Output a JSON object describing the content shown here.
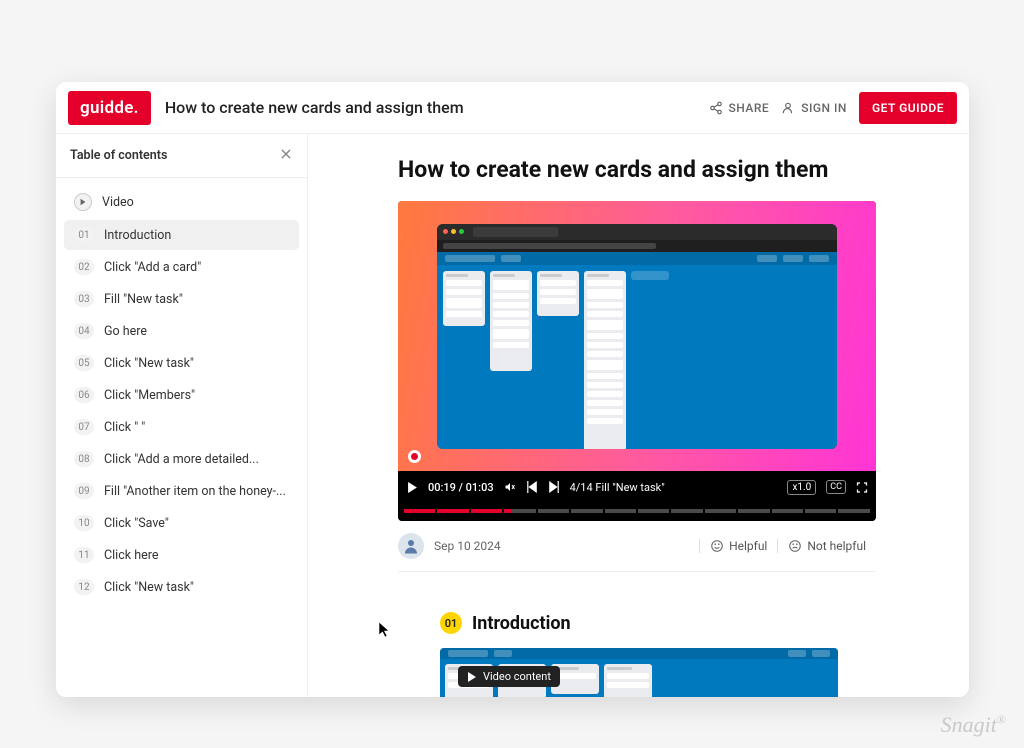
{
  "brand": "guidde",
  "header": {
    "title": "How to create new cards and assign them",
    "share": "Share",
    "sign_in": "Sign In",
    "cta": "Get Guidde"
  },
  "toc": {
    "title": "Table of contents",
    "video_label": "Video",
    "items": [
      {
        "num": "01",
        "label": "Introduction"
      },
      {
        "num": "02",
        "label": "Click \"Add a card\""
      },
      {
        "num": "03",
        "label": "Fill \"New task\""
      },
      {
        "num": "04",
        "label": "Go here"
      },
      {
        "num": "05",
        "label": "Click \"New task\""
      },
      {
        "num": "06",
        "label": "Click \"Members\""
      },
      {
        "num": "07",
        "label": "Click \"              \""
      },
      {
        "num": "08",
        "label": "Click \"Add a more detailed..."
      },
      {
        "num": "09",
        "label": "Fill \"Another item on the honey-..."
      },
      {
        "num": "10",
        "label": "Click \"Save\""
      },
      {
        "num": "11",
        "label": "Click here"
      },
      {
        "num": "12",
        "label": "Click \"New task\""
      }
    ]
  },
  "video": {
    "time_current": "00:19",
    "time_total": "01:03",
    "time_display": "00:19 / 01:03",
    "chapter_label": "4/14 Fill \"New task\"",
    "speed": "x1.0",
    "cc": "CC",
    "chapters_total": 14,
    "chapters_done": 3,
    "chapter_partial": 0.25
  },
  "meta": {
    "date": "Sep 10 2024",
    "helpful": "Helpful",
    "not_helpful": "Not helpful"
  },
  "section1": {
    "num": "01",
    "title": "Introduction",
    "pill": "Video content"
  },
  "watermark": "Snagit"
}
